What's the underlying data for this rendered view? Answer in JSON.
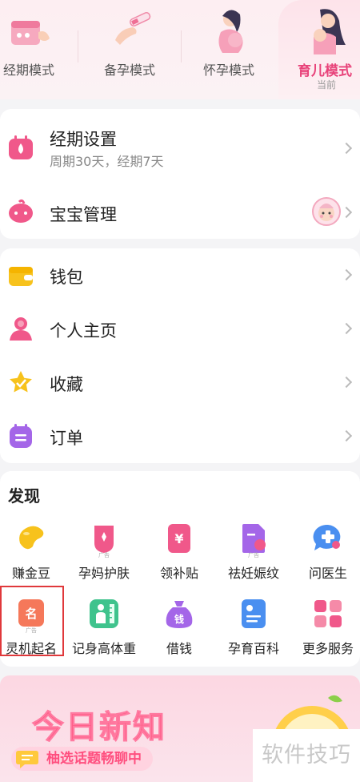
{
  "modes": [
    {
      "label": "经期模式",
      "icon": "period-mode-illustration"
    },
    {
      "label": "备孕模式",
      "icon": "prepare-pregnancy-illustration"
    },
    {
      "label": "怀孕模式",
      "icon": "pregnancy-illustration"
    },
    {
      "label": "育儿模式",
      "icon": "parenting-illustration",
      "sub": "当前",
      "active": true
    }
  ],
  "settings": {
    "period": {
      "title": "经期设置",
      "desc": "周期30天，经期7天",
      "icon": "calendar-drop-icon"
    },
    "baby": {
      "title": "宝宝管理",
      "icon": "baby-face-icon"
    }
  },
  "menu": [
    {
      "label": "钱包",
      "icon": "wallet-icon"
    },
    {
      "label": "个人主页",
      "icon": "person-icon"
    },
    {
      "label": "收藏",
      "icon": "star-icon"
    },
    {
      "label": "订单",
      "icon": "order-list-icon"
    }
  ],
  "discover": {
    "title": "发现",
    "ad_tag": "广告",
    "items": [
      {
        "label": "赚金豆",
        "icon": "gold-bean-icon"
      },
      {
        "label": "孕妈护肤",
        "icon": "skincare-icon",
        "ad": true
      },
      {
        "label": "领补贴",
        "icon": "subsidy-icon",
        "glyph": "¥"
      },
      {
        "label": "祛妊娠纹",
        "icon": "stretch-mark-icon",
        "ad": true
      },
      {
        "label": "问医生",
        "icon": "doctor-chat-icon"
      },
      {
        "label": "灵机起名",
        "icon": "naming-icon",
        "glyph": "名",
        "ad": true
      },
      {
        "label": "记身高体重",
        "icon": "height-weight-icon"
      },
      {
        "label": "借钱",
        "icon": "money-bag-icon",
        "glyph": "钱"
      },
      {
        "label": "孕育百科",
        "icon": "encyclopedia-icon"
      },
      {
        "label": "更多服务",
        "icon": "more-services-icon"
      }
    ]
  },
  "banner": {
    "title": "今日新知",
    "pill": "柚选话题畅聊中"
  },
  "watermark": "软件技巧",
  "colors": {
    "accent": "#e8437a",
    "highlight": "#e0393b"
  }
}
